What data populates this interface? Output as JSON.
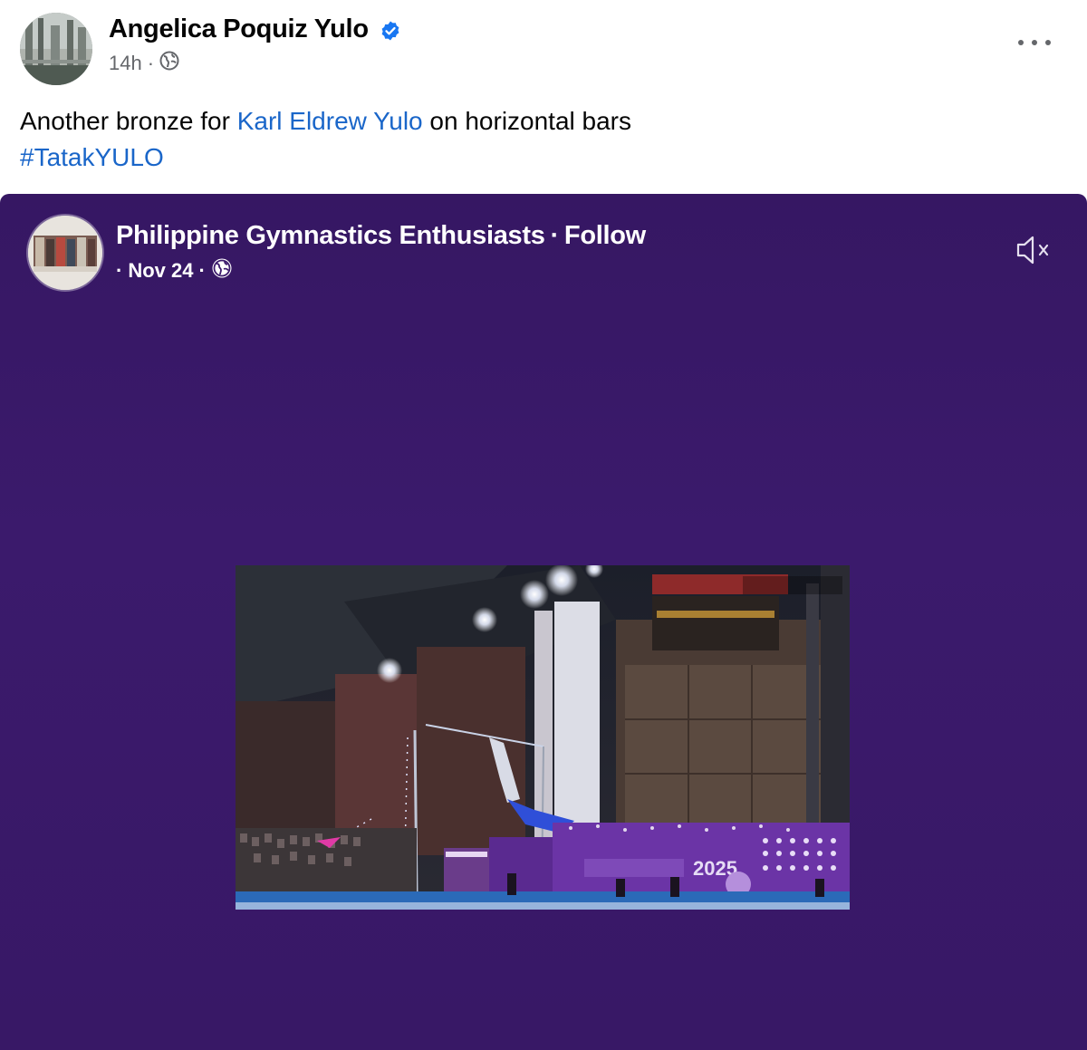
{
  "post": {
    "author": "Angelica Poquiz Yulo",
    "time": "14h",
    "dot": "·",
    "audience_icon": "globe-icon",
    "more_icon": "more-options-icon",
    "verified_icon": "verified-badge-icon",
    "caption_before": "Another bronze for ",
    "caption_link": "Karl Eldrew Yulo",
    "caption_after": " on horizontal bars",
    "hashtag": "#TatakYULO"
  },
  "shared": {
    "page_name": "Philippine Gymnastics Enthusiasts",
    "separator": "·",
    "follow_label": "Follow",
    "leading_dot": "·",
    "date": "Nov 24",
    "dot": "·",
    "audience_icon": "globe-icon",
    "mute_icon": "muted-speaker-icon",
    "video_overlay_text": "2025"
  },
  "colors": {
    "link": "#1a66c9",
    "shared_background": "#3b1a6c",
    "meta": "#65676b"
  }
}
